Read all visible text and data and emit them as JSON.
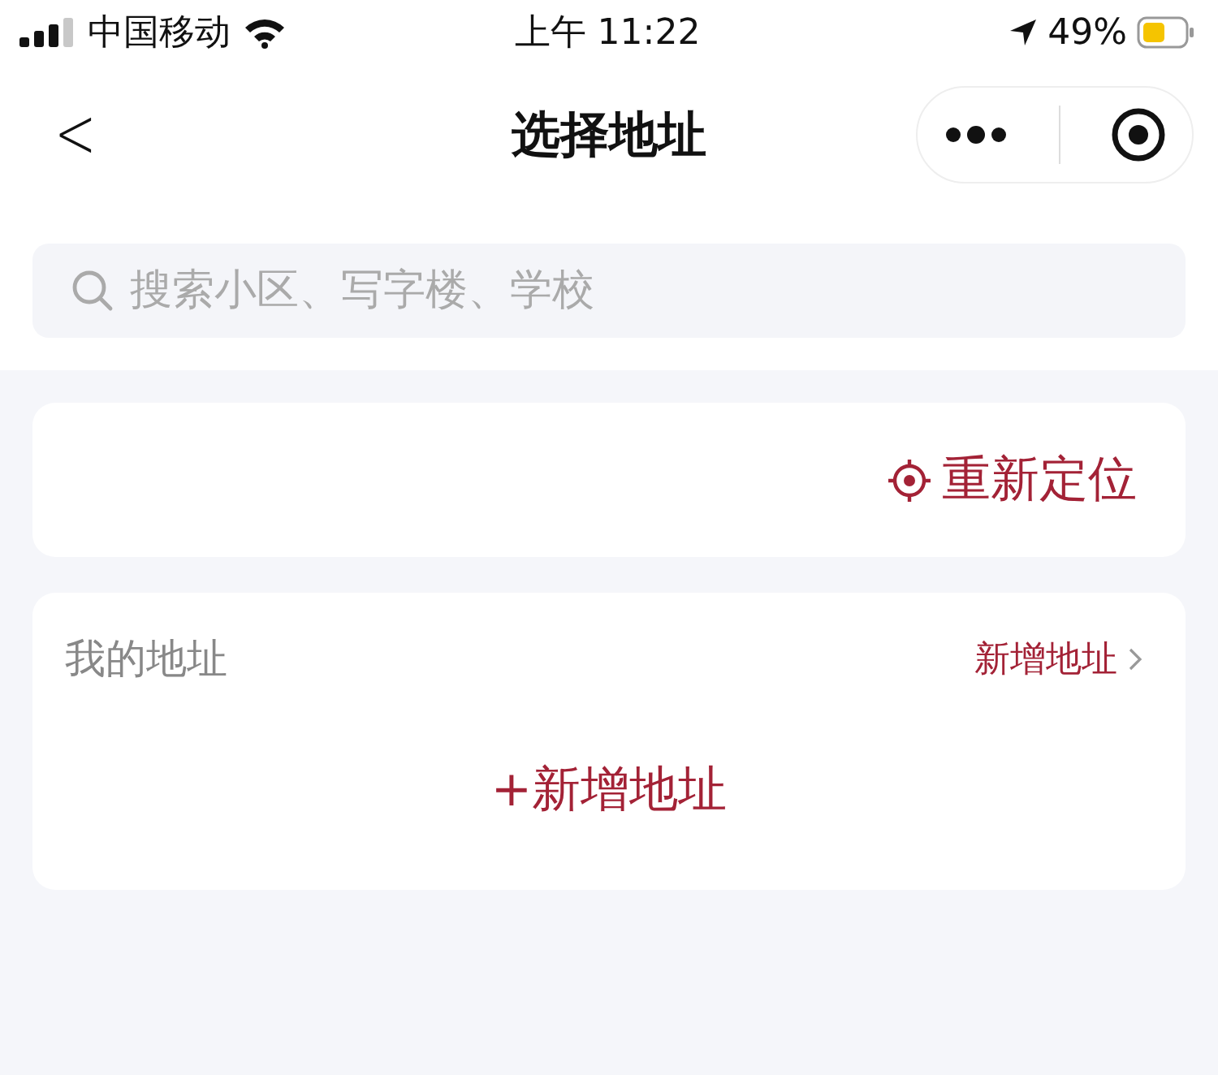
{
  "status_bar": {
    "carrier": "中国移动",
    "time": "上午 11:22",
    "battery": "49%"
  },
  "nav": {
    "back": "<",
    "title": "选择地址"
  },
  "search": {
    "placeholder": "搜索小区、写字楼、学校"
  },
  "relocate": {
    "label": "重新定位"
  },
  "my_addresses": {
    "title": "我的地址",
    "link": "新增地址",
    "add": "+新增地址"
  }
}
